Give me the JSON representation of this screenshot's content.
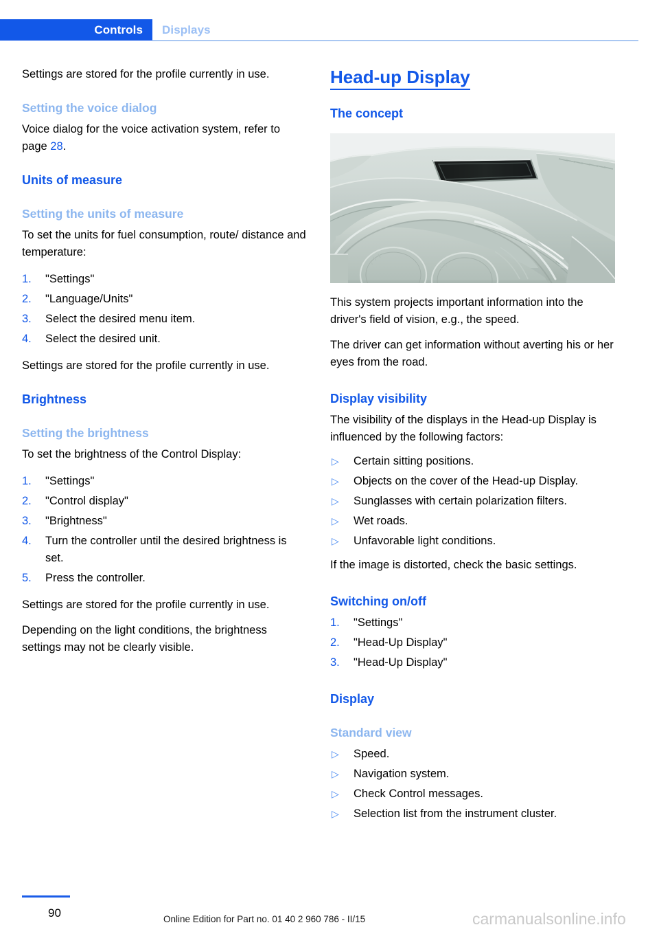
{
  "header": {
    "tab_active": "Controls",
    "tab_inactive": "Displays",
    "accent_blue": "#1258e8",
    "muted_blue": "#9cc0f5"
  },
  "left_column": {
    "intro_paragraph": "Settings are stored for the profile currently in use.",
    "voice_dialog": {
      "subheading": "Setting the voice dialog",
      "text_before_link": "Voice dialog for the voice activation system, refer to page ",
      "page_link": "28",
      "text_after_link": "."
    },
    "units_of_measure": {
      "heading": "Units of measure",
      "subheading": "Setting the units of measure",
      "intro": "To set the units for fuel consumption, route/ distance and temperature:",
      "steps": [
        {
          "num": "1.",
          "text": "\"Settings\""
        },
        {
          "num": "2.",
          "text": "\"Language/Units\""
        },
        {
          "num": "3.",
          "text": "Select the desired menu item."
        },
        {
          "num": "4.",
          "text": "Select the desired unit."
        }
      ],
      "closing": "Settings are stored for the profile currently in use."
    },
    "brightness": {
      "heading": "Brightness",
      "subheading": "Setting the brightness",
      "intro": "To set the brightness of the Control Display:",
      "steps": [
        {
          "num": "1.",
          "text": "\"Settings\""
        },
        {
          "num": "2.",
          "text": "\"Control display\""
        },
        {
          "num": "3.",
          "text": "\"Brightness\""
        },
        {
          "num": "4.",
          "text": "Turn the controller until the desired brightness is set."
        },
        {
          "num": "5.",
          "text": "Press the controller."
        }
      ],
      "closing_1": "Settings are stored for the profile currently in use.",
      "closing_2": "Depending on the light conditions, the brightness settings may not be clearly visible."
    }
  },
  "right_column": {
    "chapter_title": "Head-up Display",
    "concept": {
      "heading": "The concept",
      "figure_alt": "dashboard-head-up-display-cover-illustration",
      "paragraph_1": "This system projects important information into the driver's field of vision, e.g., the speed.",
      "paragraph_2": "The driver can get information without averting his or her eyes from the road."
    },
    "display_visibility": {
      "heading": "Display visibility",
      "intro": "The visibility of the displays in the Head-up Display is influenced by the following factors:",
      "bullet_glyph": "▷",
      "bullets": [
        "Certain sitting positions.",
        "Objects on the cover of the Head-up Display.",
        "Sunglasses with certain polarization filters.",
        "Wet roads.",
        "Unfavorable light conditions."
      ],
      "closing": "If the image is distorted, check the basic settings."
    },
    "switching": {
      "heading": "Switching on/off",
      "steps": [
        {
          "num": "1.",
          "text": "\"Settings\""
        },
        {
          "num": "2.",
          "text": "\"Head-Up Display\""
        },
        {
          "num": "3.",
          "text": "\"Head-Up Display\""
        }
      ]
    },
    "display": {
      "heading": "Display",
      "subheading": "Standard view",
      "bullet_glyph": "▷",
      "bullets": [
        "Speed.",
        "Navigation system.",
        "Check Control messages.",
        "Selection list from the instrument cluster."
      ]
    }
  },
  "footer": {
    "page_number": "90",
    "edition_note": "Online Edition for Part no. 01 40 2 960 786 - II/15",
    "watermark": "carmanualsonline.info"
  }
}
